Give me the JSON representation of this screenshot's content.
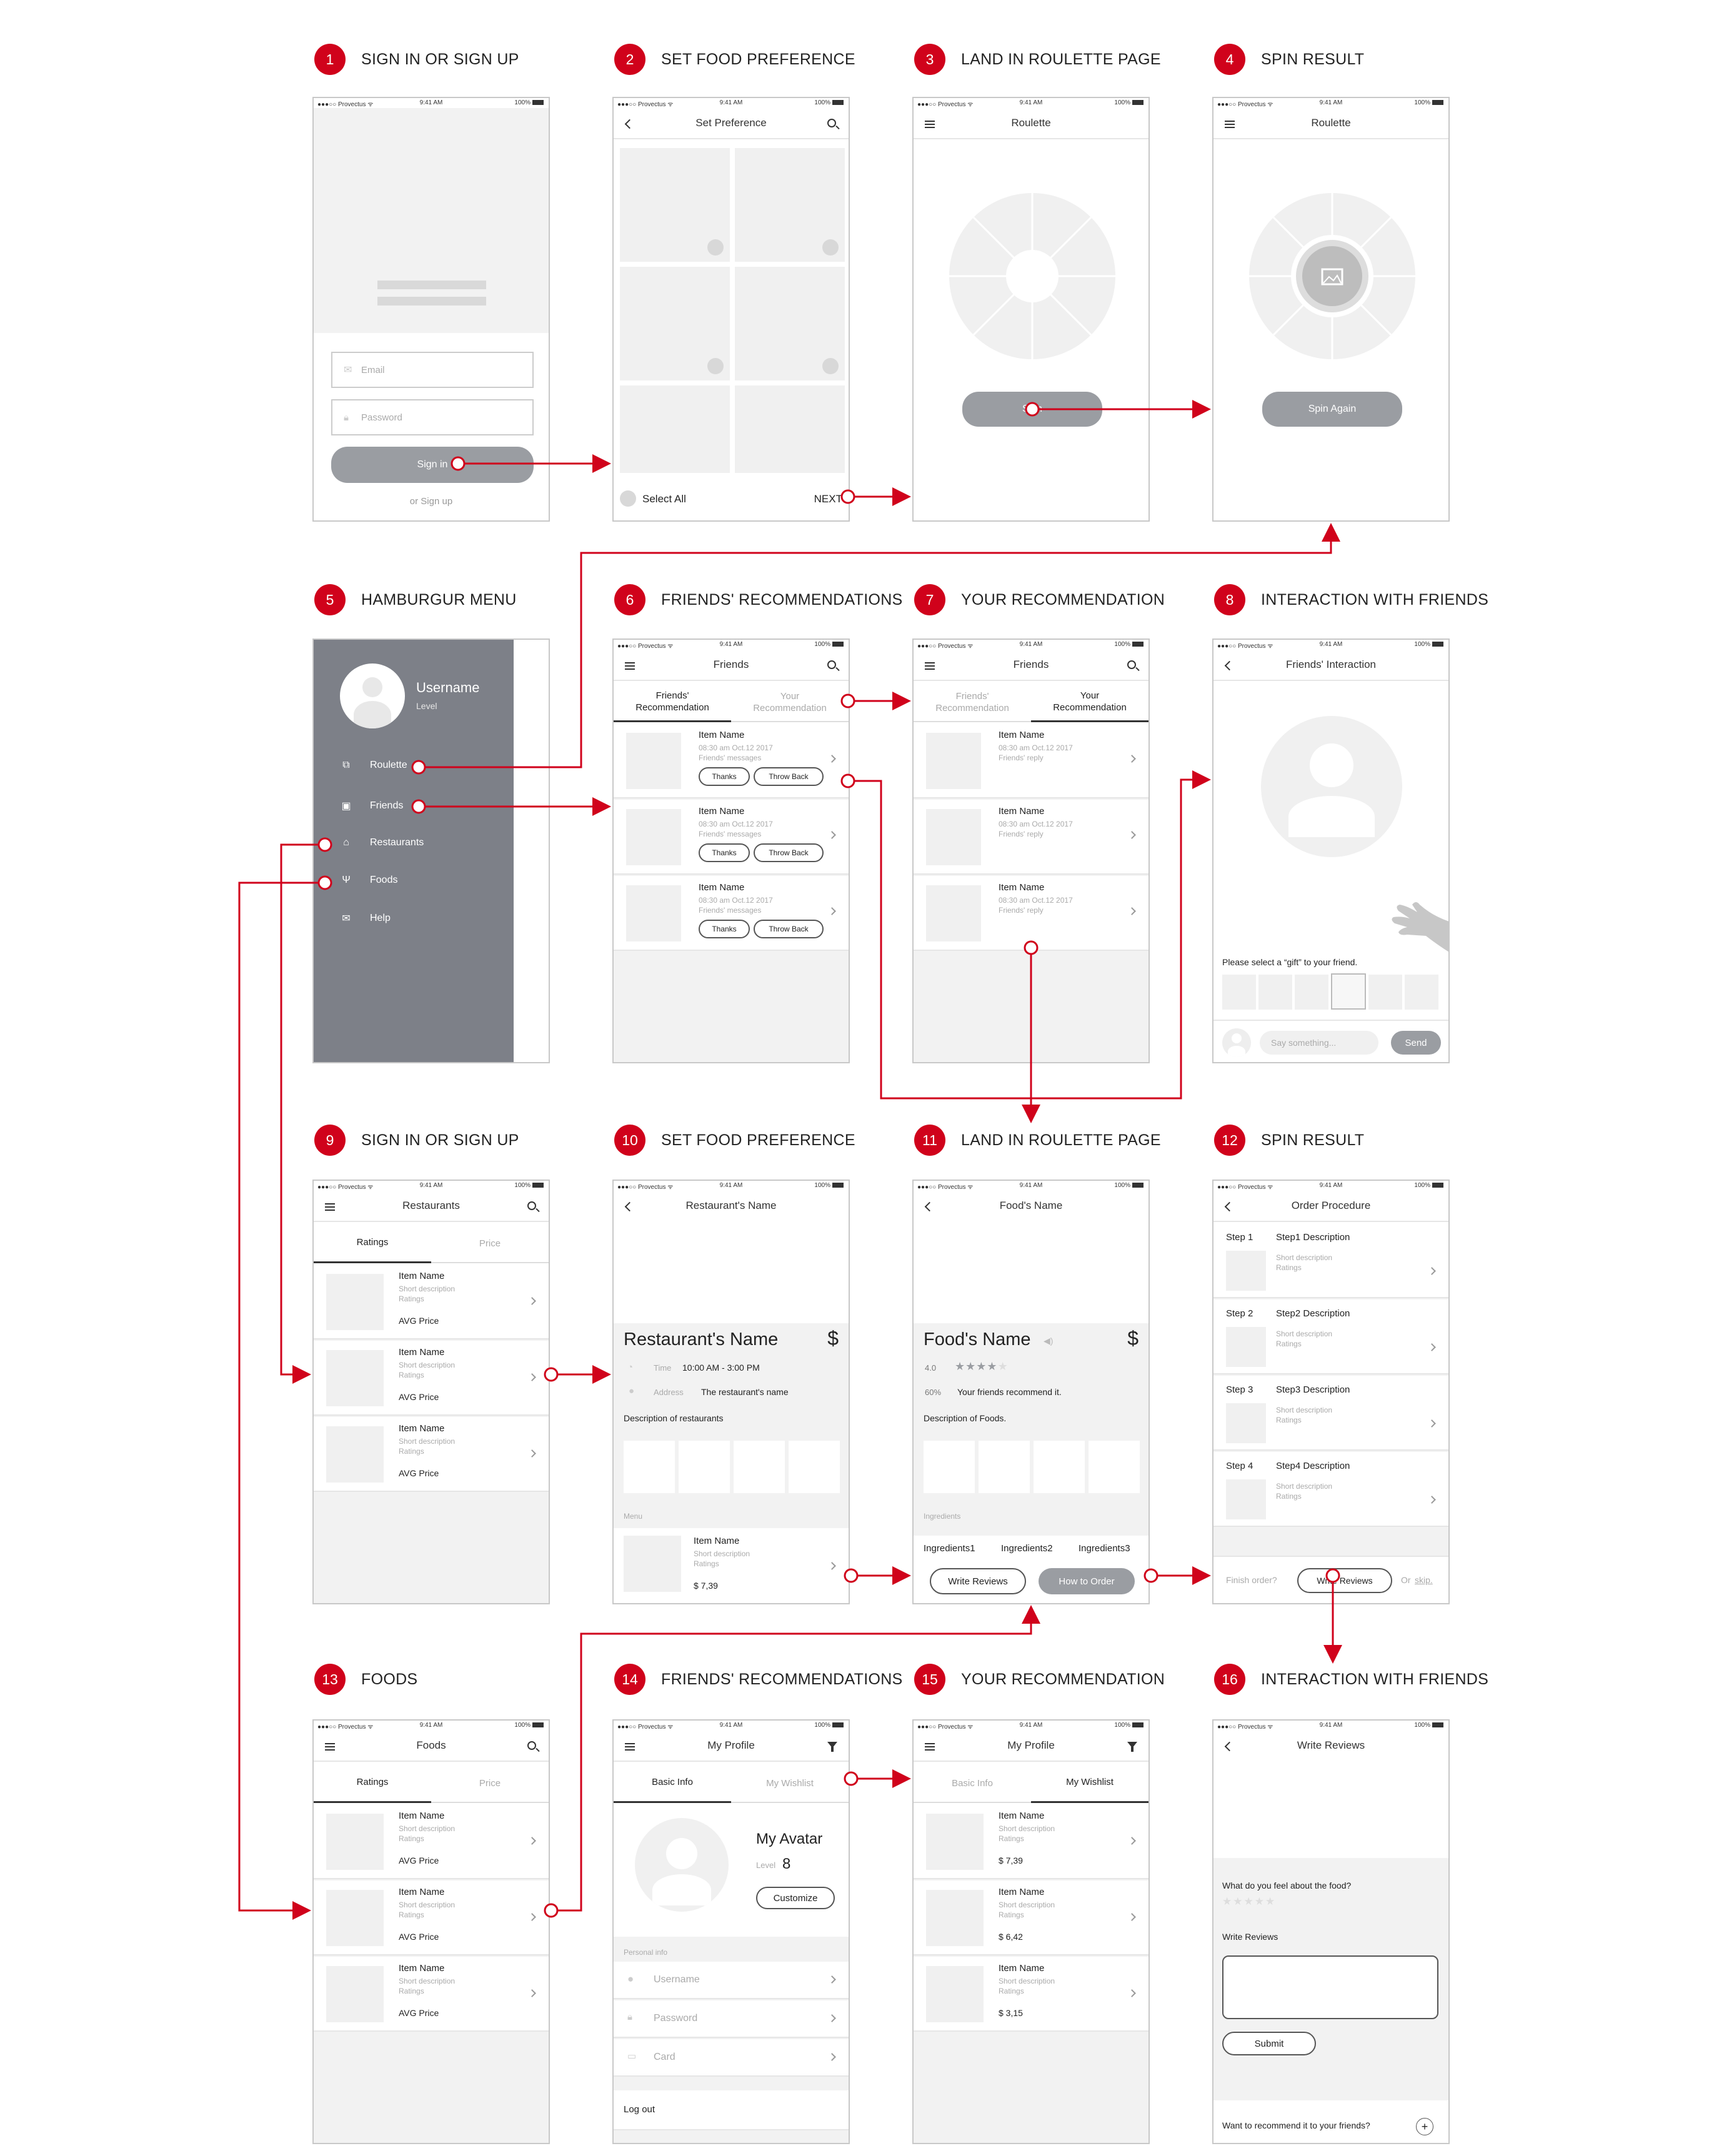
{
  "accent_color": "#d0021b",
  "steps": [
    {
      "num": "1",
      "title": "SIGN IN OR SIGN UP"
    },
    {
      "num": "2",
      "title": "SET FOOD PREFERENCE"
    },
    {
      "num": "3",
      "title": "LAND IN ROULETTE PAGE"
    },
    {
      "num": "4",
      "title": "SPIN RESULT"
    },
    {
      "num": "5",
      "title": "HAMBURGUR MENU"
    },
    {
      "num": "6",
      "title": "FRIENDS' RECOMMENDATIONS"
    },
    {
      "num": "7",
      "title": "YOUR RECOMMENDATION"
    },
    {
      "num": "8",
      "title": "INTERACTION WITH FRIENDS"
    },
    {
      "num": "9",
      "title": "SIGN IN OR SIGN UP"
    },
    {
      "num": "10",
      "title": "SET FOOD PREFERENCE"
    },
    {
      "num": "11",
      "title": "LAND IN ROULETTE PAGE"
    },
    {
      "num": "12",
      "title": "SPIN RESULT"
    },
    {
      "num": "13",
      "title": "FOODS"
    },
    {
      "num": "14",
      "title": "FRIENDS' RECOMMENDATIONS"
    },
    {
      "num": "15",
      "title": "YOUR RECOMMENDATION"
    },
    {
      "num": "16",
      "title": "INTERACTION WITH FRIENDS"
    }
  ],
  "statusbar": {
    "carrier": "●●●○○ Provectus ᯤ",
    "time": "9:41 AM",
    "battery": "100%"
  },
  "s1": {
    "email": "Email",
    "password": "Password",
    "signin": "Sign in",
    "signup": "or Sign up"
  },
  "s2": {
    "title": "Set Preference",
    "select_all": "Select  All",
    "next": "NEXT"
  },
  "s3": {
    "title": "Roulette",
    "spin": "Spin"
  },
  "s4": {
    "title": "Roulette",
    "spin_again": "Spin Again"
  },
  "s5": {
    "username": "Username",
    "level": "Level",
    "items": [
      "Roulette",
      "Friends",
      "Restaurants",
      "Foods",
      "Help"
    ]
  },
  "s6": {
    "title": "Friends",
    "tab1": "Friends' Recommendation",
    "tab2": "Your Recommendation",
    "items": [
      {
        "name": "Item Name",
        "time": "08:30 am Oct.12 2017",
        "msg": "Friends' messages",
        "b1": "Thanks",
        "b2": "Throw Back"
      },
      {
        "name": "Item Name",
        "time": "08:30 am Oct.12 2017",
        "msg": "Friends' messages",
        "b1": "Thanks",
        "b2": "Throw Back"
      },
      {
        "name": "Item Name",
        "time": "08:30 am Oct.12 2017",
        "msg": "Friends' messages",
        "b1": "Thanks",
        "b2": "Throw Back"
      }
    ]
  },
  "s7": {
    "title": "Friends",
    "tab1": "Friends' Recommendation",
    "tab2": "Your Recommendation",
    "items": [
      {
        "name": "Item Name",
        "time": "08:30 am Oct.12 2017",
        "msg": "Friends' reply"
      },
      {
        "name": "Item Name",
        "time": "08:30 am Oct.12 2017",
        "msg": "Friends' reply"
      },
      {
        "name": "Item Name",
        "time": "08:30 am Oct.12 2017",
        "msg": "Friends' reply"
      }
    ]
  },
  "s8": {
    "title": "Friends' Interaction",
    "gift": "Please select a “gift” to your friend.",
    "say": "Say something...",
    "send": "Send"
  },
  "s9": {
    "title": "Restaurants",
    "tab1": "Ratings",
    "tab2": "Price",
    "items": [
      {
        "name": "Item Name",
        "desc": "Short description",
        "rating": "Ratings",
        "price": "AVG Price"
      },
      {
        "name": "Item Name",
        "desc": "Short description",
        "rating": "Ratings",
        "price": "AVG Price"
      },
      {
        "name": "Item Name",
        "desc": "Short description",
        "rating": "Ratings",
        "price": "AVG Price"
      }
    ]
  },
  "s10": {
    "title": "Restaurant's Name",
    "name": "Restaurant's Name",
    "dollar": "$",
    "time_label": "Time",
    "time": "10:00 AM - 3:00 PM",
    "addr_label": "Address",
    "addr": "The restaurant's name",
    "desc": "Description of restaurants",
    "menu": "Menu",
    "item": {
      "name": "Item Name",
      "desc": "Short description",
      "rating": "Ratings",
      "price": "$ 7,39"
    }
  },
  "s11": {
    "title": "Food's Name",
    "name": "Food's Name",
    "dollar": "$",
    "rating": "4.0",
    "stars": 4,
    "pct": "60%",
    "rec": "Your friends recommend it.",
    "desc": "Description of Foods.",
    "ing_label": "Ingredients",
    "ings": [
      "Ingredients1",
      "Ingredients2",
      "Ingredients3"
    ],
    "write": "Write Reviews",
    "order": "How to Order"
  },
  "s12": {
    "title": "Order Procedure",
    "steps": [
      {
        "label": "Step 1",
        "name": "Step1 Description",
        "desc": "Short description",
        "rating": "Ratings"
      },
      {
        "label": "Step 2",
        "name": "Step2 Description",
        "desc": "Short description",
        "rating": "Ratings"
      },
      {
        "label": "Step 3",
        "name": "Step3 Description",
        "desc": "Short description",
        "rating": "Ratings"
      },
      {
        "label": "Step 4",
        "name": "Step4 Description",
        "desc": "Short description",
        "rating": "Ratings"
      }
    ],
    "finish": "Finish order?",
    "write": "Write Reviews",
    "or": "Or",
    "skip": "skip."
  },
  "s13": {
    "title": "Foods",
    "tab1": "Ratings",
    "tab2": "Price",
    "items": [
      {
        "name": "Item Name",
        "desc": "Short description",
        "rating": "Ratings",
        "price": "AVG Price"
      },
      {
        "name": "Item Name",
        "desc": "Short description",
        "rating": "Ratings",
        "price": "AVG Price"
      },
      {
        "name": "Item Name",
        "desc": "Short description",
        "rating": "Ratings",
        "price": "AVG Price"
      }
    ]
  },
  "s14": {
    "title": "My Profile",
    "tab1": "Basic Info",
    "tab2": "My Wishlist",
    "avatar": "My Avatar",
    "level_label": "Level",
    "level": "8",
    "customize": "Customize",
    "personal": "Personal info",
    "fields": [
      "Username",
      "Password",
      "Card"
    ],
    "logout": "Log out"
  },
  "s15": {
    "title": "My Profile",
    "tab1": "Basic Info",
    "tab2": "My Wishlist",
    "items": [
      {
        "name": "Item Name",
        "desc": "Short description",
        "rating": "Ratings",
        "price": "$ 7,39"
      },
      {
        "name": "Item Name",
        "desc": "Short description",
        "rating": "Ratings",
        "price": "$ 6,42"
      },
      {
        "name": "Item Name",
        "desc": "Short description",
        "rating": "Ratings",
        "price": "$ 3,15"
      }
    ]
  },
  "s16": {
    "title": "Write Reviews",
    "q": "What do you feel about the food?",
    "label": "Write Reviews",
    "submit": "Submit",
    "recommend": "Want to recommend it to your friends?"
  }
}
